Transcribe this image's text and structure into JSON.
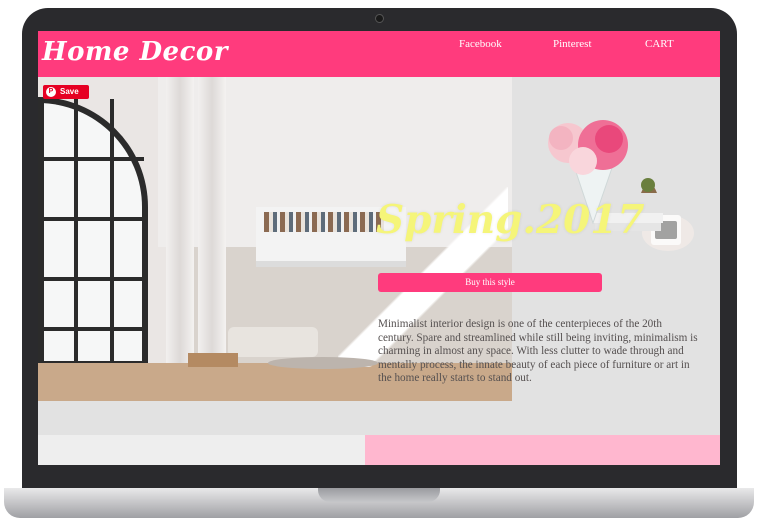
{
  "site": {
    "logo": "Home Decor",
    "nav": [
      {
        "label": "Facebook"
      },
      {
        "label": "Pinterest"
      },
      {
        "label": "CART"
      }
    ]
  },
  "pin_button": {
    "label": "Save",
    "icon": "pinterest-icon"
  },
  "hero": {
    "headline": "Spring.2017",
    "cta_label": "Buy this style",
    "description": "Minimalist interior design is one of the centerpieces of the 20th century. Spare and streamlined while still being inviting, minimalism is charming in almost any space. With less clutter to wade through and mentally process, the innate beauty of each piece of furniture or art in the home really starts to stand out."
  },
  "colors": {
    "brand_pink": "#ff3b7d",
    "headline_yellow": "#f5f579",
    "section_pink": "#ffb7cf"
  }
}
